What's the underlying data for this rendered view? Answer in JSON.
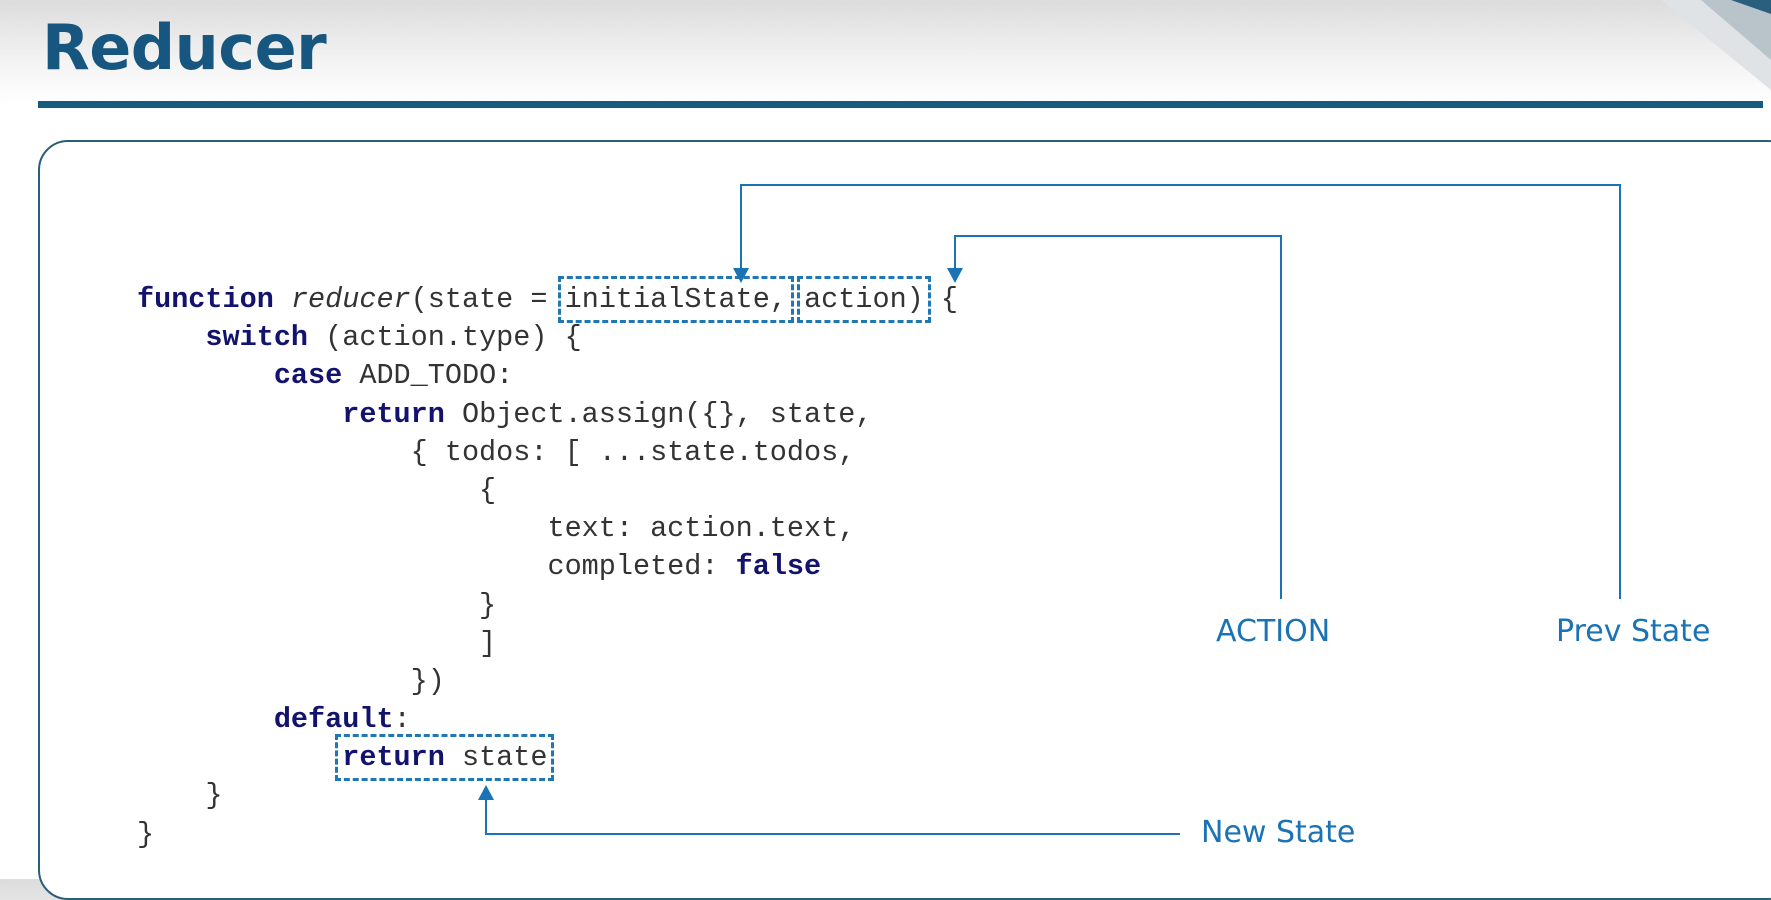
{
  "slide": {
    "title": "Reducer"
  },
  "code": {
    "lines": [
      [
        {
          "t": "function",
          "k": "kw"
        },
        {
          "t": " "
        },
        {
          "t": "reducer",
          "k": "fn"
        },
        {
          "t": "(state = "
        },
        {
          "t": "initialState,",
          "k": "hl",
          "n": "initial-state-param"
        },
        {
          "t": " "
        },
        {
          "t": "action)",
          "k": "hl",
          "n": "action-param"
        },
        {
          "t": " {"
        }
      ],
      [
        {
          "t": "    "
        },
        {
          "t": "switch",
          "k": "kw"
        },
        {
          "t": " (action.type) {"
        }
      ],
      [
        {
          "t": "        "
        },
        {
          "t": "case",
          "k": "kw"
        },
        {
          "t": " ADD_TODO:"
        }
      ],
      [
        {
          "t": "            "
        },
        {
          "t": "return",
          "k": "kw"
        },
        {
          "t": " Object.assign({}, state,"
        }
      ],
      [
        {
          "t": "                { todos: [ ...state.todos,"
        }
      ],
      [
        {
          "t": "                    {"
        }
      ],
      [
        {
          "t": "                        text: action.text,"
        }
      ],
      [
        {
          "t": "                        completed: "
        },
        {
          "t": "false",
          "k": "kw"
        }
      ],
      [
        {
          "t": "                    }"
        }
      ],
      [
        {
          "t": "                    ]"
        }
      ],
      [
        {
          "t": "                })"
        }
      ],
      [
        {
          "t": "        "
        },
        {
          "t": "default",
          "k": "kw"
        },
        {
          "t": ":"
        }
      ],
      [
        {
          "t": "            "
        },
        {
          "t": "return state",
          "k": "hl",
          "n": "return-state-statement",
          "parts": [
            {
              "t": "return",
              "k": "kw"
            },
            {
              "t": " state"
            }
          ]
        }
      ],
      [
        {
          "t": "    }"
        }
      ],
      [
        {
          "t": "}"
        }
      ]
    ]
  },
  "annotations": {
    "action_label": "ACTION",
    "prev_state_label": "Prev State",
    "new_state_label": "New State"
  },
  "colors": {
    "title": "#16567f",
    "keyword": "#13136e",
    "annotation": "#1a73b4",
    "highlight_border": "#1f78b4"
  }
}
